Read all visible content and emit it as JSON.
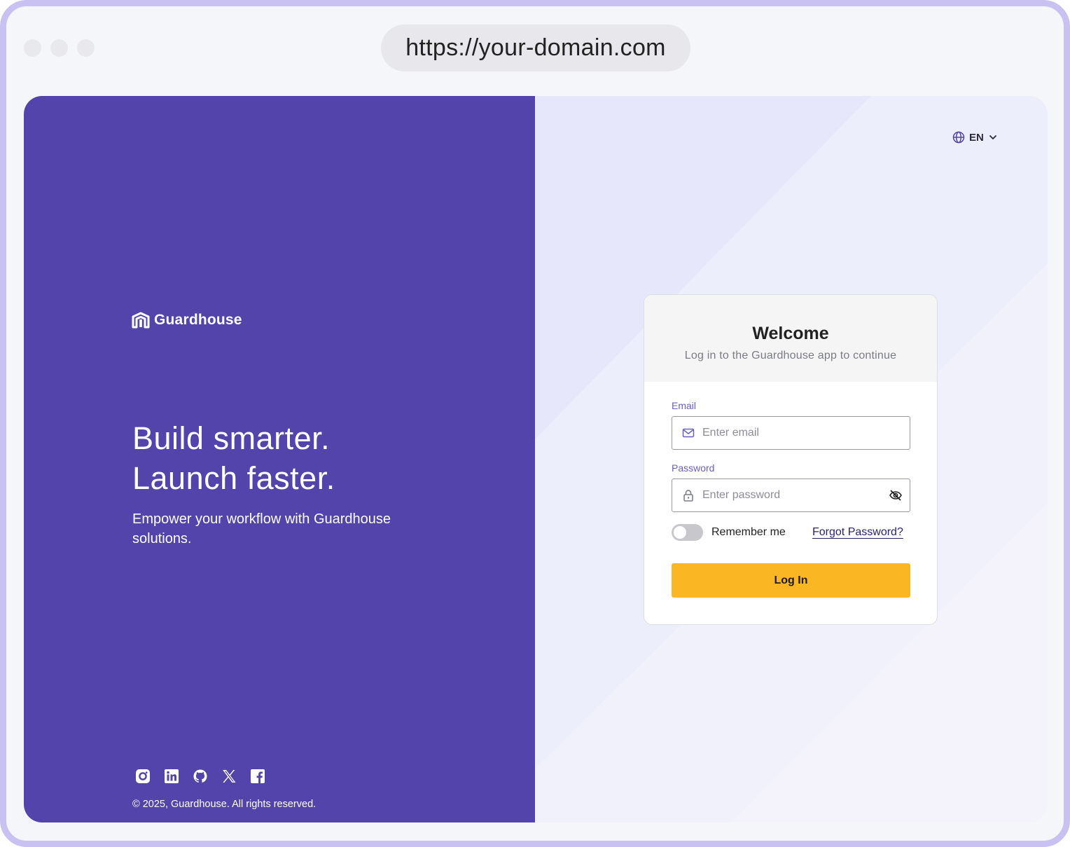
{
  "browser": {
    "url": "https://your-domain.com"
  },
  "brand": {
    "name": "Guardhouse",
    "headline_line1": "Build smarter.",
    "headline_line2": "Launch faster.",
    "tagline": "Empower your workflow with Guardhouse solutions.",
    "copyright": "© 2025, Guardhouse. All rights reserved.",
    "social_icons": [
      "instagram-icon",
      "linkedin-icon",
      "github-icon",
      "x-icon",
      "facebook-icon"
    ]
  },
  "language": {
    "selected": "EN"
  },
  "login_card": {
    "title": "Welcome",
    "subtitle": "Log in to the Guardhouse app to continue",
    "email_label": "Email",
    "email_placeholder": "Enter email",
    "email_value": "",
    "password_label": "Password",
    "password_placeholder": "Enter password",
    "password_value": "",
    "remember_label": "Remember me",
    "remember_checked": false,
    "forgot_label": "Forgot Password?",
    "login_label": "Log In"
  },
  "colors": {
    "brand_purple": "#5244ab",
    "accent_yellow": "#fbb623",
    "frame_border": "#c9c1f2"
  }
}
